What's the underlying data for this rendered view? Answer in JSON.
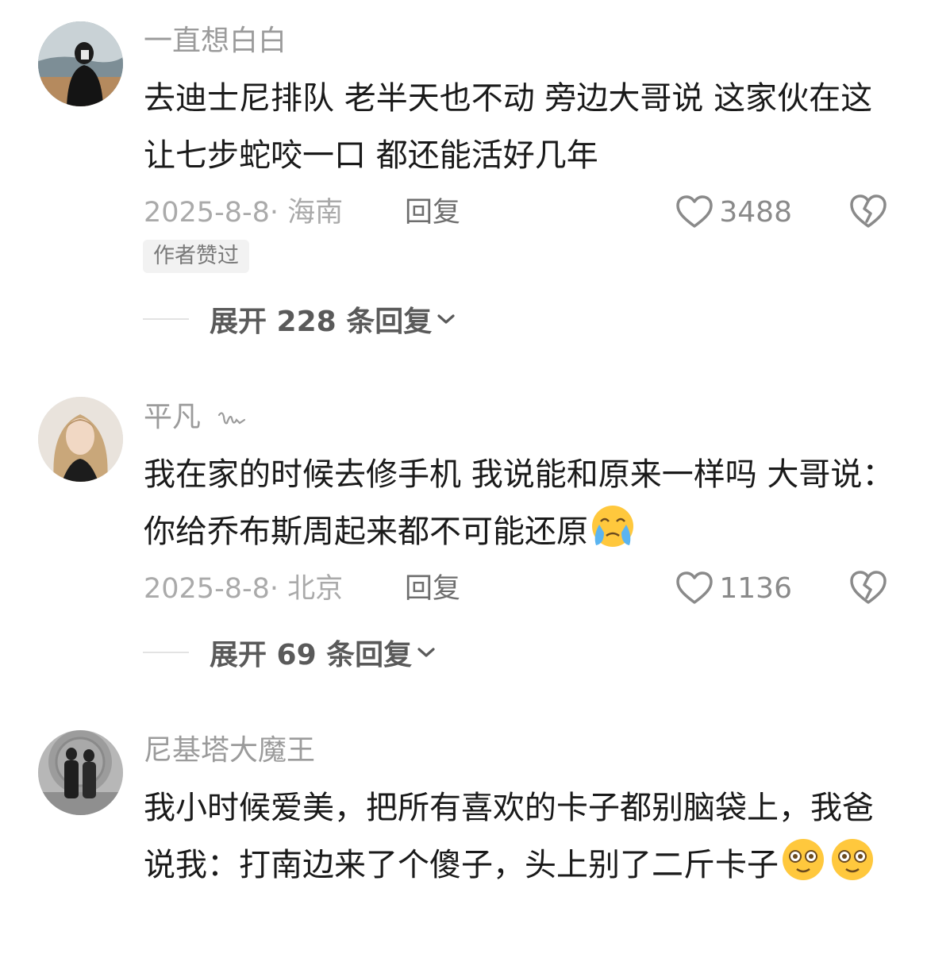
{
  "comments": [
    {
      "username": "一直想白白",
      "text": "去迪士尼排队 老半天也不动 旁边大哥说 这家伙在这让七步蛇咬一口 都还能活好几年",
      "date_location": "2025-8-8· 海南",
      "reply_label": "回复",
      "likes": "3488",
      "badge": "作者赞过",
      "expand_label": "展开 228 条回复"
    },
    {
      "username": "平凡",
      "username_icon": "signature-mark-icon",
      "text": "我在家的时候去修手机 我说能和原来一样吗 大哥说：你给乔布斯周起来都不可能还原",
      "emoji": "crying-face-emoji",
      "date_location": "2025-8-8· 北京",
      "reply_label": "回复",
      "likes": "1136",
      "expand_label": "展开 69 条回复"
    },
    {
      "username": "尼基塔大魔王",
      "text": "我小时候爱美，把所有喜欢的卡子都别脑袋上，我爸说我：打南边来了个傻子，头上别了二斤卡子",
      "emoji": "dizzy-face-emoji"
    }
  ],
  "colors": {
    "text": "#1a1a1a",
    "muted": "#9b9b9b",
    "badge_bg": "#f2f2f2",
    "emoji_yellow": "#ffc83d"
  }
}
